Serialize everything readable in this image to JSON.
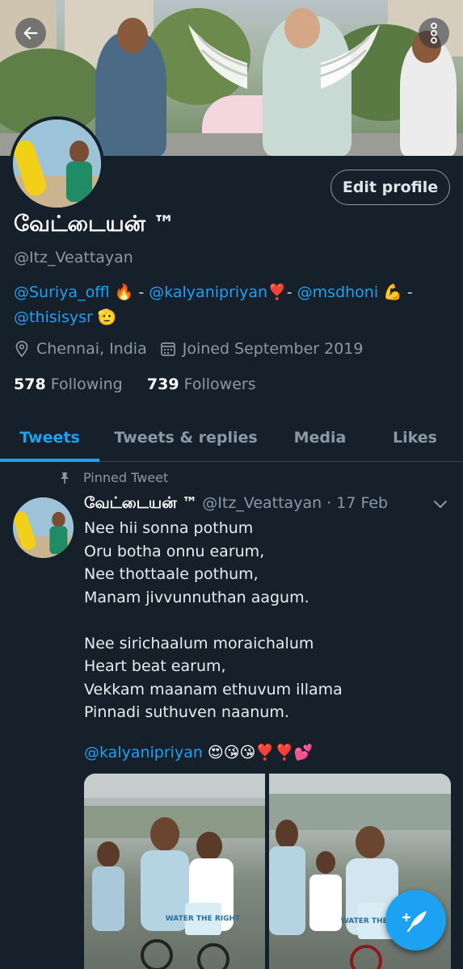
{
  "header": {
    "back_icon": "arrow-left-icon",
    "more_icon": "more-vertical-icon"
  },
  "profile": {
    "edit_label": "Edit profile",
    "name": "வேட்டையன் ™",
    "handle": "@Itz_Veattayan",
    "bio": {
      "m1": "@Suriya_offl",
      "e1": " 🔥 - ",
      "m2": "@kalyanipriyan",
      "e2": "❣️- ",
      "m3": "@msdhoni",
      "e3": " 💪 - ",
      "m4": "@thisisysr",
      "e4": " 🫡"
    },
    "location": "Chennai, India",
    "joined": "Joined September 2019",
    "following_count": "578",
    "following_label": "Following",
    "followers_count": "739",
    "followers_label": "Followers"
  },
  "tabs": [
    {
      "label": "Tweets",
      "active": true
    },
    {
      "label": "Tweets & replies",
      "active": false
    },
    {
      "label": "Media",
      "active": false
    },
    {
      "label": "Likes",
      "active": false
    }
  ],
  "tweet": {
    "pinned_label": "Pinned Tweet",
    "author_name": "வேட்டையன் ™",
    "author_meta": "@Itz_Veattayan · 17 Feb",
    "lines": [
      "Nee hii sonna pothum",
      "Oru botha onnu earum,",
      "Nee thottaale pothum,",
      "Manam jivvunnuthan aagum.",
      "",
      "Nee sirichaalum moraichalum",
      "Heart beat earum,",
      "Vekkam maanam ethuvum illama",
      "Pinnadi suthuven naanum."
    ],
    "mention": "@kalyanipriyan",
    "mention_emojis": " 😍😘😘❣️❣️💕",
    "media_sign_left": "WATER THE RIGHT",
    "media_sign_right": "WATER THE RIGHT"
  },
  "fab": {
    "icon": "compose-feather-icon"
  },
  "colors": {
    "background": "#15202b",
    "accent": "#1da1f2",
    "secondary_text": "#8b98a5",
    "divider": "#38444d"
  }
}
